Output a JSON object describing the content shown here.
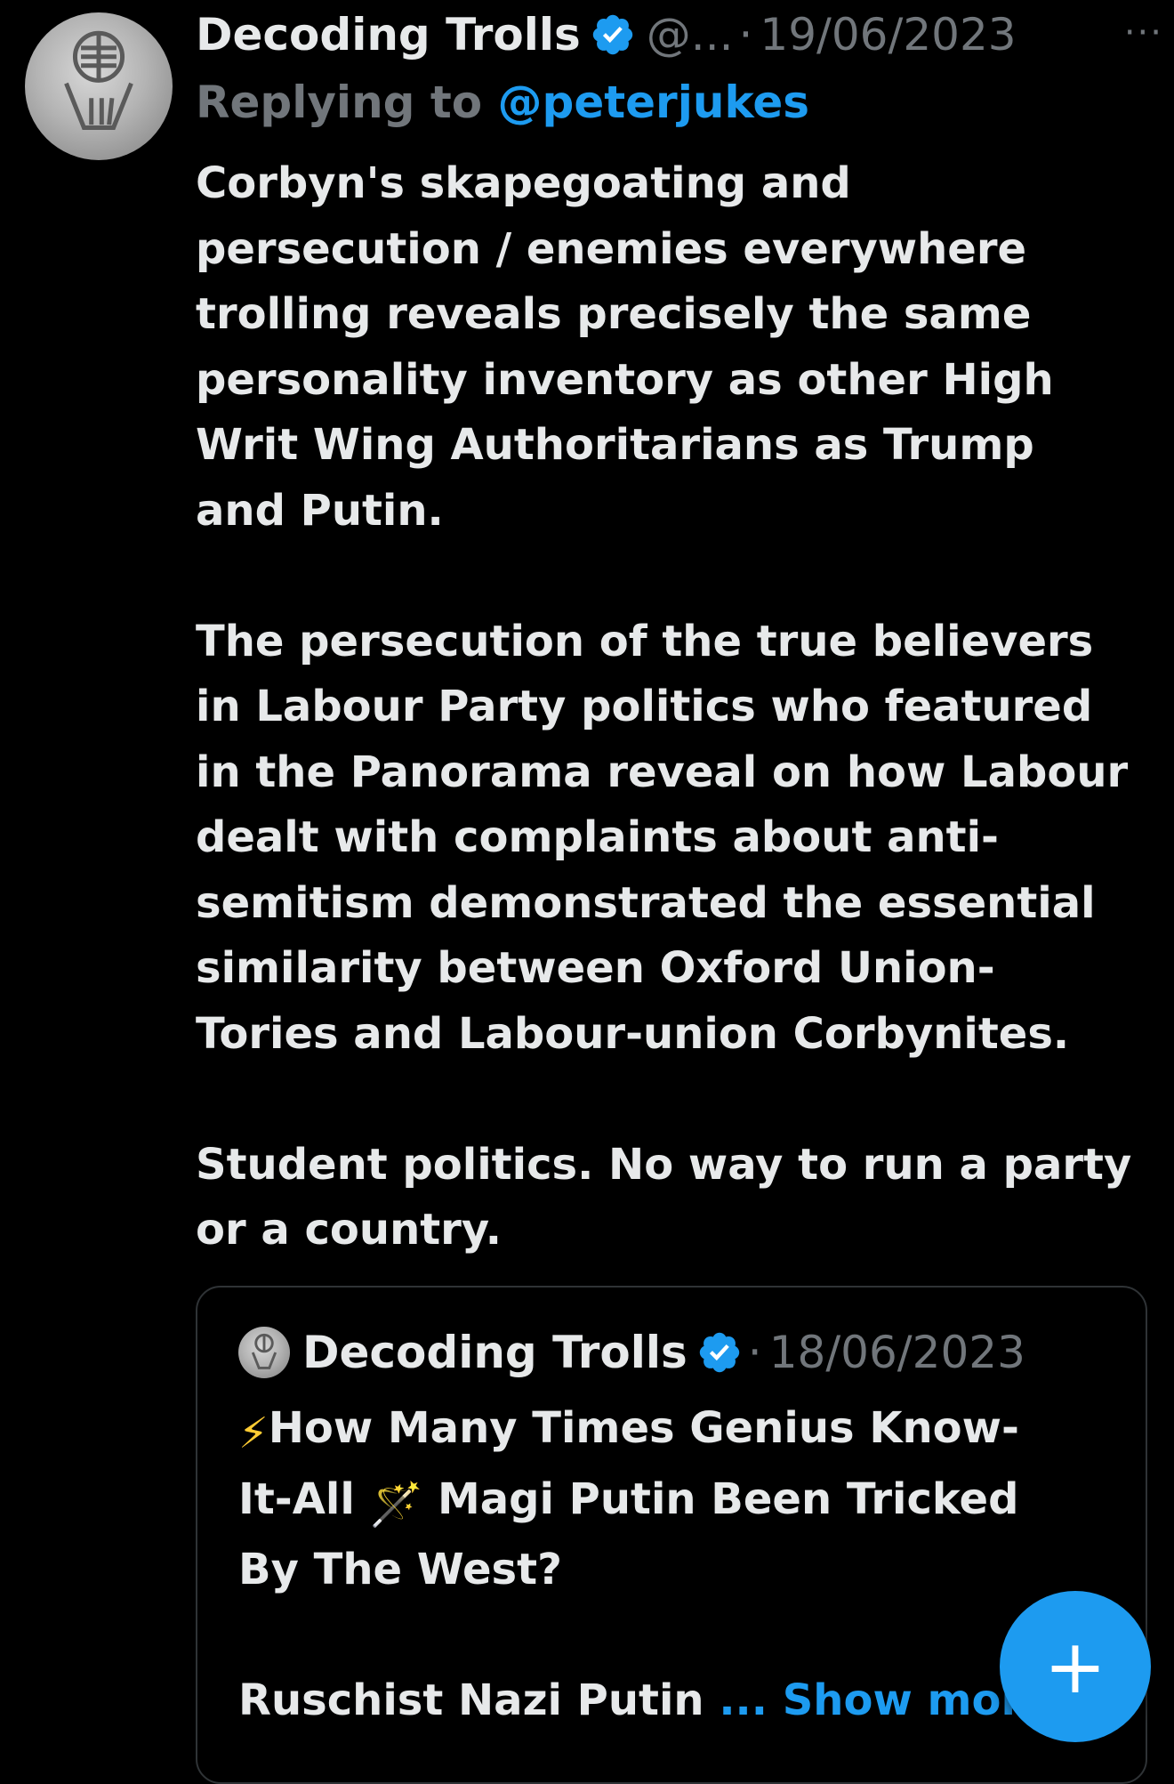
{
  "tweet": {
    "display_name": "Decoding Trolls",
    "handle": "@...",
    "separator": "·",
    "date": "19/06/2023",
    "more_icon": "···",
    "replying_label": "Replying to ",
    "replying_mention": "@peterjukes",
    "body_lines": [
      "Corbyn's skapegoating and",
      "persecution / enemies everywhere",
      "trolling reveals precisely the same",
      "personality inventory as other High",
      "Writ Wing Authoritarians as Trump",
      "and Putin.",
      "",
      "The persecution of the true believers",
      "in Labour Party politics who featured",
      "in the Panorama reveal on how Labour",
      "dealt with complaints about anti-",
      "semitism demonstrated the essential",
      "similarity between Oxford Union-",
      "Tories and Labour-union Corbynites.",
      "",
      "Student politics. No way to run a party",
      "or a country."
    ]
  },
  "quote": {
    "display_name": "Decoding Trolls",
    "separator": "·",
    "date": "18/06/2023",
    "line1_emoji": "⚡",
    "line1_text": "How Many Times Genius Know-",
    "line2_a": "It-All ",
    "line2_emoji": "🪄",
    "line2_b": " Magi Putin Been Tricked",
    "line3": "By The West?",
    "line5": "Ruschist Nazi Putin ",
    "show_more": "... Show more"
  },
  "fab": {
    "label": "+",
    "icon": "plus-icon"
  },
  "colors": {
    "background": "#000000",
    "text": "#e7e9ea",
    "muted": "#71767b",
    "accent": "#1d9bf0"
  }
}
